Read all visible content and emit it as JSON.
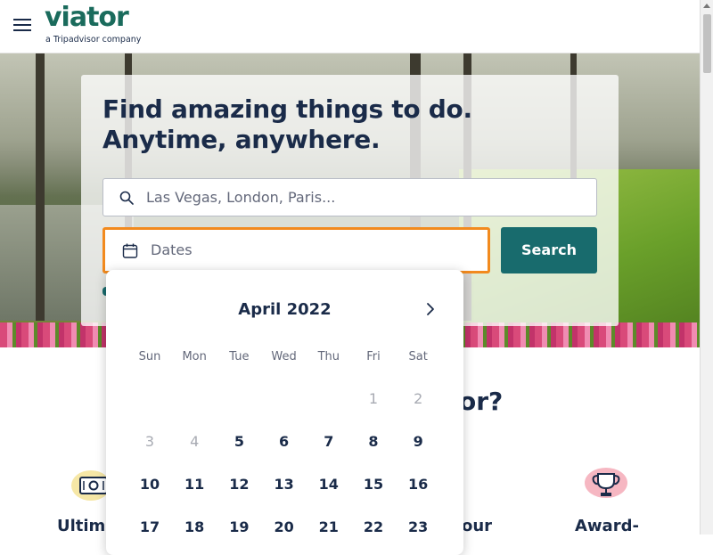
{
  "header": {
    "logo": "viator",
    "logo_sub": "a Tripadvisor company"
  },
  "hero": {
    "headline_line1": "Find amazing things to do.",
    "headline_line2": "Anytime, anywhere.",
    "search_placeholder": "Las Vegas, London, Paris...",
    "dates_placeholder": "Dates",
    "search_button": "Search"
  },
  "section": {
    "title_fragment": "or?",
    "features": [
      {
        "label": "Ultima",
        "icon": "money-icon"
      },
      {
        "label": "our",
        "icon": ""
      },
      {
        "label": "Award-",
        "icon": "trophy-icon"
      }
    ]
  },
  "calendar": {
    "month": "April 2022",
    "weekdays": [
      "Sun",
      "Mon",
      "Tue",
      "Wed",
      "Thu",
      "Fri",
      "Sat"
    ],
    "weeks": [
      [
        null,
        null,
        null,
        null,
        null,
        {
          "d": "1",
          "disabled": true
        },
        {
          "d": "2",
          "disabled": true
        }
      ],
      [
        {
          "d": "3",
          "disabled": true
        },
        {
          "d": "4",
          "disabled": true
        },
        {
          "d": "5"
        },
        {
          "d": "6"
        },
        {
          "d": "7"
        },
        {
          "d": "8"
        },
        {
          "d": "9"
        }
      ],
      [
        {
          "d": "10"
        },
        {
          "d": "11"
        },
        {
          "d": "12"
        },
        {
          "d": "13"
        },
        {
          "d": "14"
        },
        {
          "d": "15"
        },
        {
          "d": "16"
        }
      ],
      [
        {
          "d": "17"
        },
        {
          "d": "18"
        },
        {
          "d": "19"
        },
        {
          "d": "20"
        },
        {
          "d": "21"
        },
        {
          "d": "22"
        },
        {
          "d": "23"
        }
      ]
    ]
  },
  "colors": {
    "brand": "#1a6b5c",
    "primary_button": "#186b6d",
    "focus_border": "#f28a1e",
    "text": "#1a2b49"
  }
}
